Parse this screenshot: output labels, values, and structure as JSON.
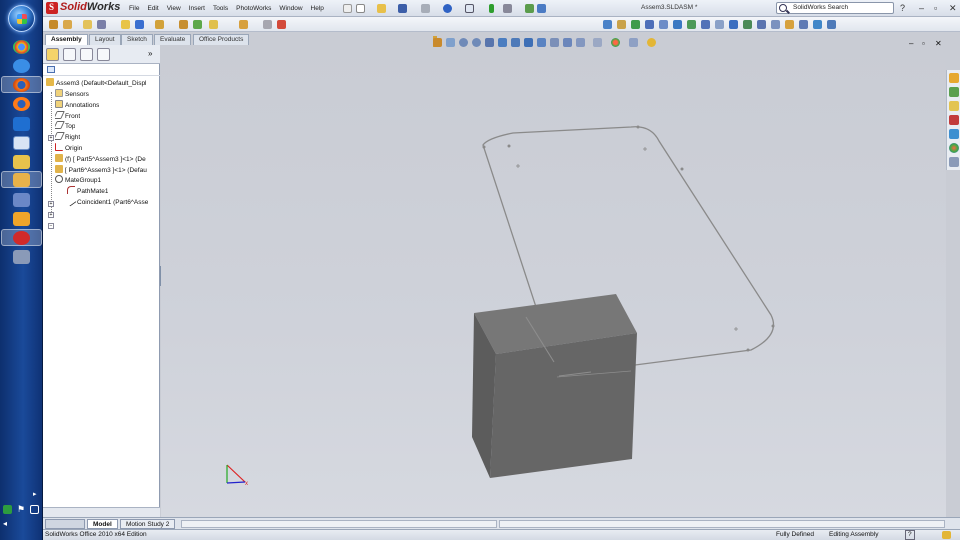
{
  "app": {
    "name_red": "Solid",
    "name_rest": "Works",
    "document_title": "Assem3.SLDASM *",
    "search_placeholder": "SolidWorks Search"
  },
  "menu": [
    "File",
    "Edit",
    "View",
    "Insert",
    "Tools",
    "PhotoWorks",
    "Window",
    "Help"
  ],
  "command_tabs": [
    {
      "label": "Assembly",
      "active": true
    },
    {
      "label": "Layout",
      "active": false
    },
    {
      "label": "Sketch",
      "active": false
    },
    {
      "label": "Evaluate",
      "active": false
    },
    {
      "label": "Office Products",
      "active": false
    }
  ],
  "feature_tree": {
    "root": "Assem3  (Default<Default_Displ",
    "items": [
      {
        "label": "Sensors",
        "icon": "sensor-icon"
      },
      {
        "label": "Annotations",
        "icon": "annotations-icon"
      },
      {
        "label": "Front",
        "icon": "plane-icon"
      },
      {
        "label": "Top",
        "icon": "plane-icon"
      },
      {
        "label": "Right",
        "icon": "plane-icon"
      },
      {
        "label": "Origin",
        "icon": "origin-icon"
      },
      {
        "label": "(f) [ Part5^Assem3 ]<1> (De",
        "icon": "part-icon"
      },
      {
        "label": "[ Part6^Assem3 ]<1> (Defau",
        "icon": "part-icon"
      },
      {
        "label": "MateGroup1",
        "icon": "mates-icon"
      },
      {
        "label": "PathMate1",
        "icon": "path-mate-icon"
      },
      {
        "label": "Coincident1 (Part6^Asse",
        "icon": "coincident-icon"
      }
    ]
  },
  "bottom_tabs": [
    {
      "label": "Model",
      "active": true
    },
    {
      "label": "Motion Study 2",
      "active": false
    }
  ],
  "status": {
    "edition": "SolidWorks Office 2010 x64 Edition",
    "state": "Fully Defined",
    "mode": "Editing Assembly",
    "help": "?"
  },
  "colors": {
    "viewport_bg": "#cdd0d8",
    "box_front": "#666666",
    "box_top": "#767676",
    "box_side": "#5d5d5d",
    "path_line": "#8a8a8a",
    "brand_red": "#b01c1c"
  },
  "taskbar_icons": [
    "chrome-icon",
    "firefox-icon",
    "firefox-icon",
    "outlook-icon",
    "word-icon",
    "explorer-icon",
    "chrome-icon",
    "solidworks-icon",
    "media-icon",
    "solidworks-icon",
    "network-icon"
  ]
}
